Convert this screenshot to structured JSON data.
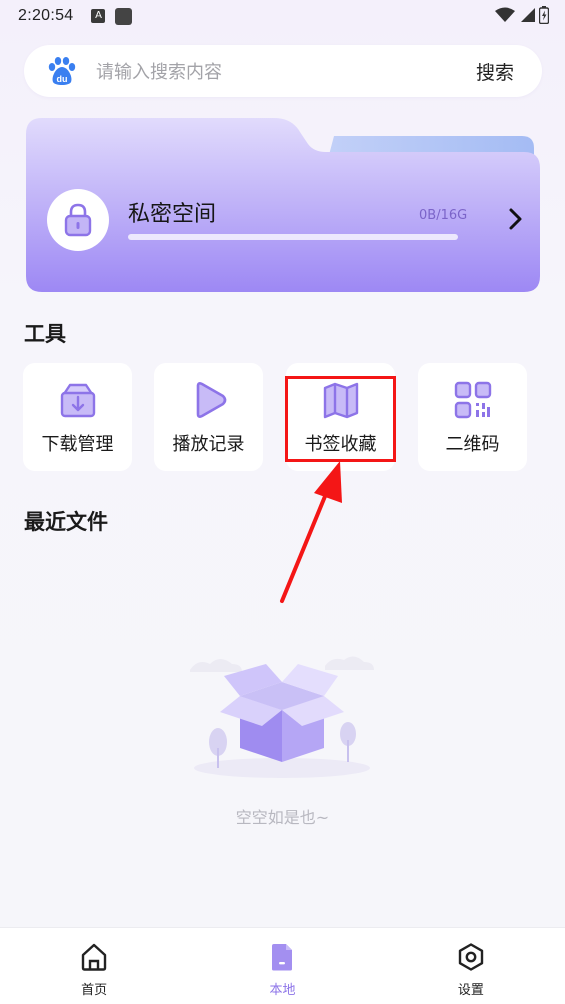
{
  "status": {
    "time": "2:20:54",
    "a_badge": "A"
  },
  "search": {
    "placeholder": "请输入搜索内容",
    "button": "搜索",
    "logo_text": "du"
  },
  "private_space": {
    "title": "私密空间",
    "usage": "0B/16G",
    "progress": 0
  },
  "tools": {
    "section_title": "工具",
    "items": [
      {
        "label": "下载管理",
        "icon": "download-box-icon"
      },
      {
        "label": "播放记录",
        "icon": "play-icon"
      },
      {
        "label": "书签收藏",
        "icon": "book-map-icon"
      },
      {
        "label": "二维码",
        "icon": "qr-code-icon"
      }
    ]
  },
  "recent": {
    "section_title": "最近文件",
    "empty_text": "空空如是也~"
  },
  "nav": {
    "items": [
      {
        "label": "首页",
        "icon": "home-icon",
        "active": false
      },
      {
        "label": "本地",
        "icon": "local-files-icon",
        "active": true
      },
      {
        "label": "设置",
        "icon": "settings-icon",
        "active": false
      }
    ]
  },
  "colors": {
    "accent": "#8d74e8",
    "highlight": "#f41616",
    "folder_start": "#ddd6fb",
    "folder_end": "#9c86f3"
  }
}
